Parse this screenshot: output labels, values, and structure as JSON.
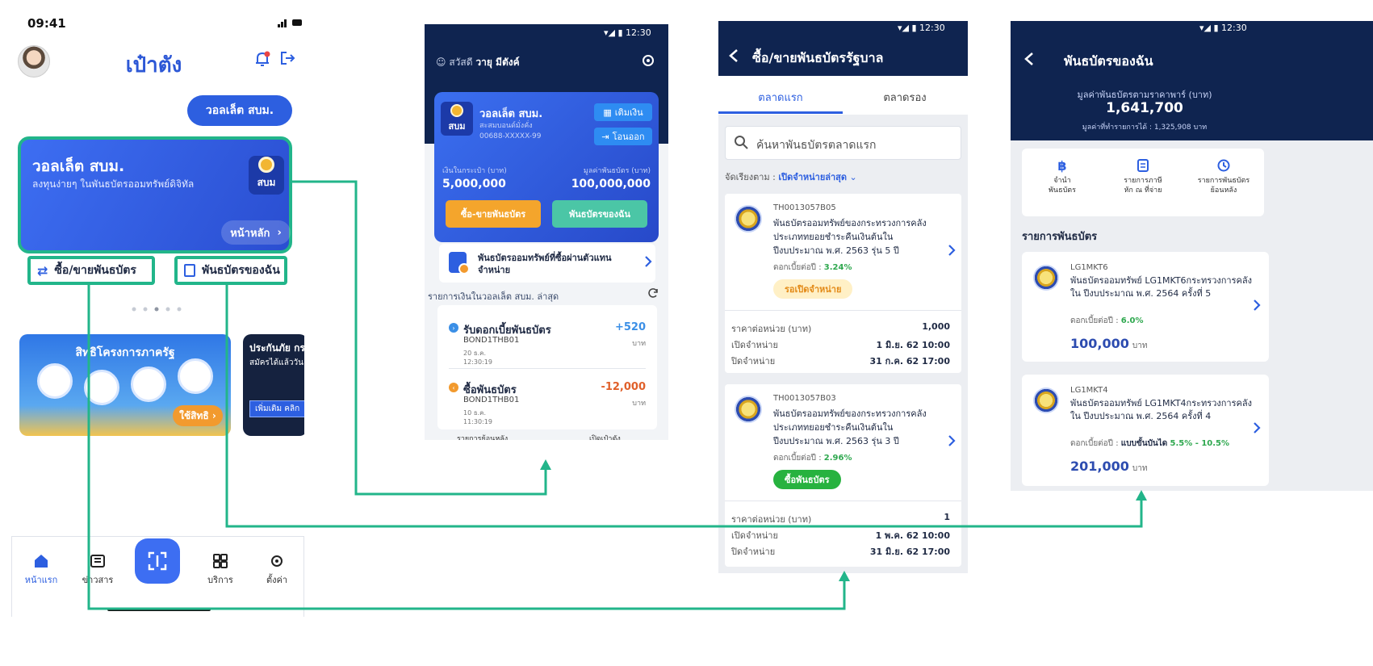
{
  "colors": {
    "accent": "#2d5fe0",
    "highlight": "#22b58a",
    "navy": "#0f2450",
    "green": "#2fa84f",
    "red": "#e0602a"
  },
  "screen1": {
    "time": "09:41",
    "title": "เป๋าตัง",
    "wallet_chip": "วอลเล็ต สบม.",
    "wallet_card": {
      "title": "วอลเล็ต สบม.",
      "subtitle": "ลงทุนง่ายๆ ในพันธบัตรออมทรัพย์ดิจิทัล",
      "logo": "สบม",
      "home_button": "หน้าหลัก"
    },
    "actions": {
      "trade": "ซื้อ/ขายพันธบัตร",
      "my_bonds": "พันธบัตรของฉัน"
    },
    "banner1": {
      "title": "สิทธิโครงการภาครัฐ",
      "cta": "ใช้สิทธิ"
    },
    "banner2": {
      "title": "ประกันภัย กร",
      "subtitle": "สมัครได้แล้ววัน",
      "cta": "เพิ่มเติม คลิก"
    },
    "nav": {
      "home": "หน้าแรก",
      "news": "ข่าวสาร",
      "services": "บริการ",
      "settings": "ตั้งค่า"
    }
  },
  "screen2": {
    "status_time": "12:30",
    "greeting_prefix": "สวัสดี",
    "user_name": "วายุ มีตังค์",
    "card": {
      "logo": "สบม",
      "name": "วอลเล็ต สบม.",
      "sub": "สะสมบอนด์มั่งคั่ง",
      "number": "00688-XXXXX-99",
      "topup": "เติมเงิน",
      "transfer": "โอนออก",
      "cash_label": "เงินในกระเป๋า (บาท)",
      "cash_value": "5,000,000",
      "bond_label": "มูลค่าพันธบัตร (บาท)",
      "bond_value": "100,000,000",
      "trade_btn": "ซื้อ-ขายพันธบัตร",
      "my_btn": "พันธบัตรของฉัน"
    },
    "agent_text": "พันธบัตรออมทรัพย์ที่ซื้อผ่านตัวแทนจำหน่าย",
    "recent_title": "รายการเงินในวอลเล็ต สบม. ล่าสุด",
    "transactions": [
      {
        "name": "รับดอกเบี้ยพันธบัตร",
        "code": "BOND1THB01",
        "date": "20 ธ.ค. 12:30:19",
        "amount": "+520",
        "unit": "บาท"
      },
      {
        "name": "ซื้อพันธบัตร",
        "code": "BOND1THB01",
        "date": "10 ธ.ค. 11:30:19",
        "amount": "-12,000",
        "unit": "บาท"
      }
    ],
    "bottom_left": "รายการย้อนหลัง",
    "bottom_right": "เปิดเป๋าตัง"
  },
  "screen3": {
    "status_time": "12:30",
    "title": "ซื้อ/ขายพันธบัตรรัฐบาล",
    "tab_primary": "ตลาดแรก",
    "tab_secondary": "ตลาดรอง",
    "search_placeholder": "ค้นหาพันธบัตรตลาดแรก",
    "sort_label": "จัดเรียงตาม :",
    "sort_value": "เปิดจำหน่ายล่าสุด",
    "bonds": [
      {
        "code": "TH0013057B05",
        "name": "พันธบัตรออมทรัพย์ของกระทรวงการคลังประเภททยอยชำระคืนเงินต้นในปีงบประมาณ พ.ศ. 2563 รุ่น 5 ปี",
        "rate_label": "ดอกเบี้ยต่อปี :",
        "rate": "3.24%",
        "tag": "รอเปิดจำหน่าย",
        "price_label": "ราคาต่อหน่วย (บาท)",
        "price": "1,000",
        "open_label": "เปิดจำหน่าย",
        "open": "1 มิ.ย. 62 10:00",
        "close_label": "ปิดจำหน่าย",
        "close": "31 ก.ค. 62 17:00"
      },
      {
        "code": "TH0013057B03",
        "name": "พันธบัตรออมทรัพย์ของกระทรวงการคลังประเภททยอยชำระคืนเงินต้นในปีงบประมาณ พ.ศ. 2563 รุ่น 3 ปี",
        "rate_label": "ดอกเบี้ยต่อปี :",
        "rate": "2.96%",
        "tag": "ซื้อพันธบัตร",
        "price_label": "ราคาต่อหน่วย (บาท)",
        "price": "1",
        "open_label": "เปิดจำหน่าย",
        "open": "1 พ.ค. 62 10:00",
        "close_label": "ปิดจำหน่าย",
        "close": "31 มิ.ย. 62 17:00"
      }
    ]
  },
  "screen4": {
    "status_time": "12:30",
    "title": "พันธบัตรของฉัน",
    "value_label": "มูลค่าพันธบัตรตามราคาพาร์ (บาท)",
    "value": "1,641,700",
    "sub_value": "มูลค่าที่ทำรายการได้ : 1,325,908 บาท",
    "menu": [
      {
        "label": "จำนำ\nพันธบัตร",
        "icon": "baht-icon"
      },
      {
        "label": "รายการภาษี\nหัก ณ ที่จ่าย",
        "icon": "document-icon"
      },
      {
        "label": "รายการพันธบัตร\nย้อนหลัง",
        "icon": "history-icon"
      }
    ],
    "section_title": "รายการพันธบัตร",
    "holdings": [
      {
        "code": "LG1MKT6",
        "name": "พันธบัตรออมทรัพย์ LG1MKT6กระทรวงการคลัง ใน ปีงบประมาณ พ.ศ. 2564 ครั้งที่ 5",
        "rate_label": "ดอกเบี้ยต่อปี :",
        "rate_text": "",
        "rate": "6.0%",
        "amount": "100,000",
        "unit": "บาท"
      },
      {
        "code": "LG1MKT4",
        "name": "พันธบัตรออมทรัพย์ LG1MKT4กระทรวงการคลัง ใน ปีงบประมาณ พ.ศ. 2564 ครั้งที่ 4",
        "rate_label": "ดอกเบี้ยต่อปี :",
        "rate_text": "แบบขั้นบันได",
        "rate": "5.5% - 10.5%",
        "amount": "201,000",
        "unit": "บาท"
      }
    ]
  }
}
